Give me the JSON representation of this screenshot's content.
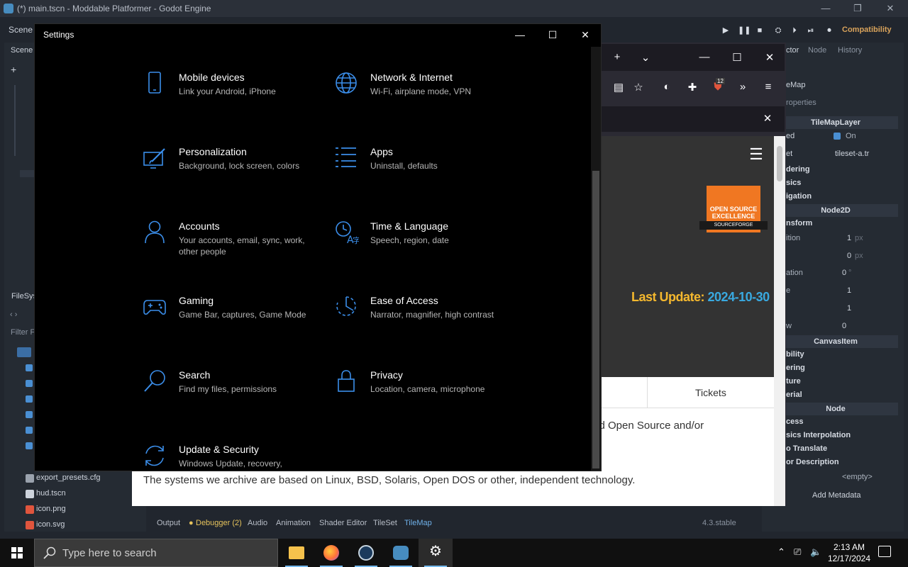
{
  "godot": {
    "title": "(*) main.tscn - Moddable Platformer - Godot Engine",
    "scene_label": "Scene",
    "compat": "Compatibility",
    "scene_dock_tab": "Scene",
    "filesystem_tab": "FileSys",
    "filter_label": "Filter Fi",
    "files": [
      "export_presets.cfg",
      "hud.tscn",
      "icon.png",
      "icon.svg"
    ],
    "inspector": {
      "tabs": [
        "ctor",
        "Node",
        "History"
      ],
      "node_select": "eMap",
      "filter_placeholder": "roperties",
      "headers": [
        "TileMapLayer",
        "Node2D",
        "CanvasItem",
        "Node"
      ],
      "enabled_value": "On",
      "tileset_value": "tileset-a.tr",
      "cats": [
        "dering",
        "sics",
        "igation",
        "nsform",
        "bility",
        "ering",
        "ture",
        "erial",
        "cess",
        "sics Interpolation",
        "o Translate",
        "or Description"
      ],
      "frag_labels": [
        "ed",
        "et",
        "ition",
        "ation",
        "e",
        "w"
      ],
      "pos_x": "1",
      "pos_y": "0",
      "px": "px",
      "rotation": "0",
      "deg": "°",
      "scale_x": "1",
      "scale_y": "1",
      "skew": "0",
      "empty": "<empty>",
      "add_metadata": "Add Metadata"
    },
    "bottom_tabs": [
      "Output",
      "Debugger (2)",
      "Audio",
      "Animation",
      "Shader Editor",
      "TileSet",
      "TileMap"
    ],
    "version": "4.3.stable"
  },
  "browser": {
    "badge_count": "12",
    "last_update_label": "Last Update:",
    "last_update_date": "2024-10-30",
    "tickets": "Tickets",
    "text1": "ted Open Source and/or",
    "text2": "The systems we archive are based on Linux, BSD, Solaris, Open DOS or other, independent technology.",
    "badge_text": "OPEN SOURCE EXCELLENCE",
    "badge_sub": "SOURCEFORGE"
  },
  "settings": {
    "title": "Settings",
    "items": [
      {
        "name": "Mobile devices",
        "desc": "Link your Android, iPhone",
        "icon": "phone-icon"
      },
      {
        "name": "Network & Internet",
        "desc": "Wi-Fi, airplane mode, VPN",
        "icon": "globe-icon"
      },
      {
        "name": "Personalization",
        "desc": "Background, lock screen, colors",
        "icon": "paint-icon"
      },
      {
        "name": "Apps",
        "desc": "Uninstall, defaults",
        "icon": "apps-list-icon"
      },
      {
        "name": "Accounts",
        "desc": "Your accounts, email, sync, work, other people",
        "icon": "person-icon"
      },
      {
        "name": "Time & Language",
        "desc": "Speech, region, date",
        "icon": "time-language-icon"
      },
      {
        "name": "Gaming",
        "desc": "Game Bar, captures, Game Mode",
        "icon": "gamepad-icon"
      },
      {
        "name": "Ease of Access",
        "desc": "Narrator, magnifier, high contrast",
        "icon": "ease-access-icon"
      },
      {
        "name": "Search",
        "desc": "Find my files, permissions",
        "icon": "search-icon"
      },
      {
        "name": "Privacy",
        "desc": "Location, camera, microphone",
        "icon": "lock-icon"
      },
      {
        "name": "Update & Security",
        "desc": "Windows Update, recovery,",
        "icon": "sync-icon"
      }
    ]
  },
  "taskbar": {
    "search_placeholder": "Type here to search",
    "time": "2:13 AM",
    "date": "12/17/2024"
  },
  "colors": {
    "accent": "#3b8eea",
    "godot_blue": "#478cbf"
  }
}
